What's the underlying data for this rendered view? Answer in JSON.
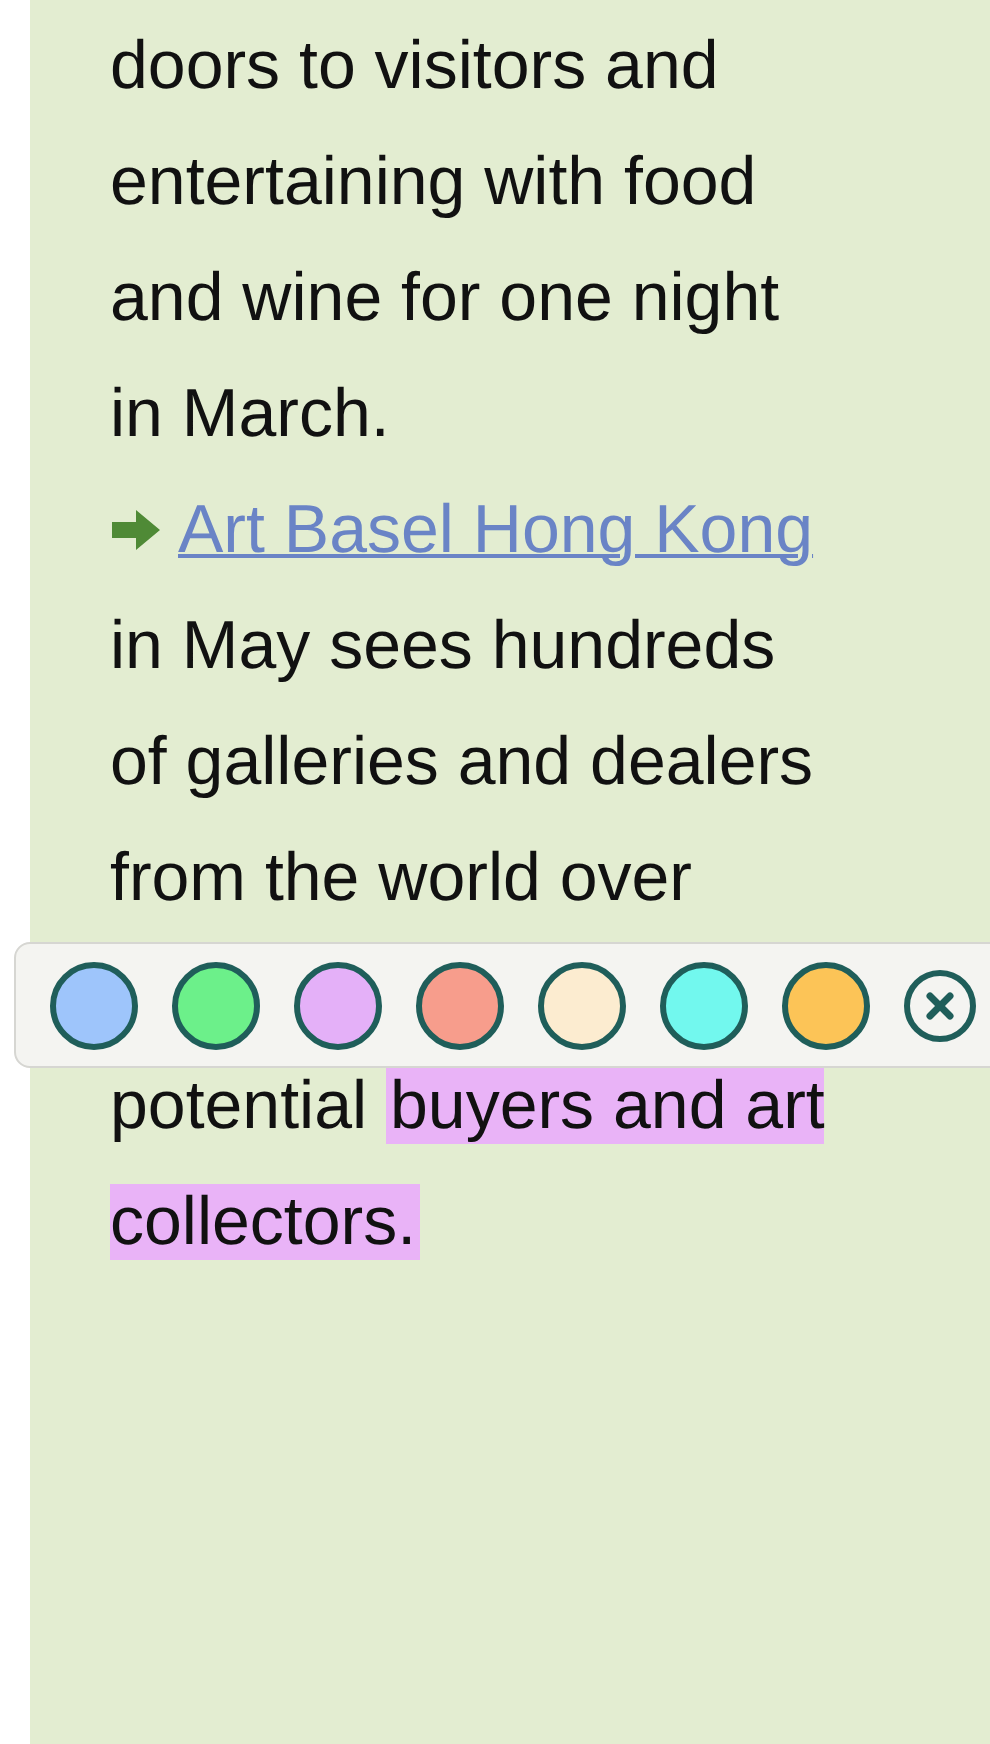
{
  "paragraphs": [
    {
      "kind": "text",
      "lines": [
        "doors to visitors and",
        "entertaining with food",
        "and wine for one night",
        "in March."
      ]
    },
    {
      "kind": "link",
      "text": "Art Basel Hong Kong"
    },
    {
      "kind": "text",
      "lines": [
        "in May sees hundreds",
        "of galleries and dealers",
        "from the world over"
      ]
    },
    {
      "kind": "toolbar",
      "swatches": [
        {
          "color": "#9ec5fb"
        },
        {
          "color": "#6cf08a"
        },
        {
          "color": "#e4b0f8"
        },
        {
          "color": "#f79d8c"
        },
        {
          "color": "#fcecd0"
        },
        {
          "color": "#72f8ee"
        },
        {
          "color": "#fcc457"
        }
      ]
    },
    {
      "kind": "highlighted",
      "segments": [
        {
          "text": "potential "
        },
        {
          "text": "buyers and art collectors.",
          "color": "#e9b3f7"
        }
      ]
    }
  ]
}
